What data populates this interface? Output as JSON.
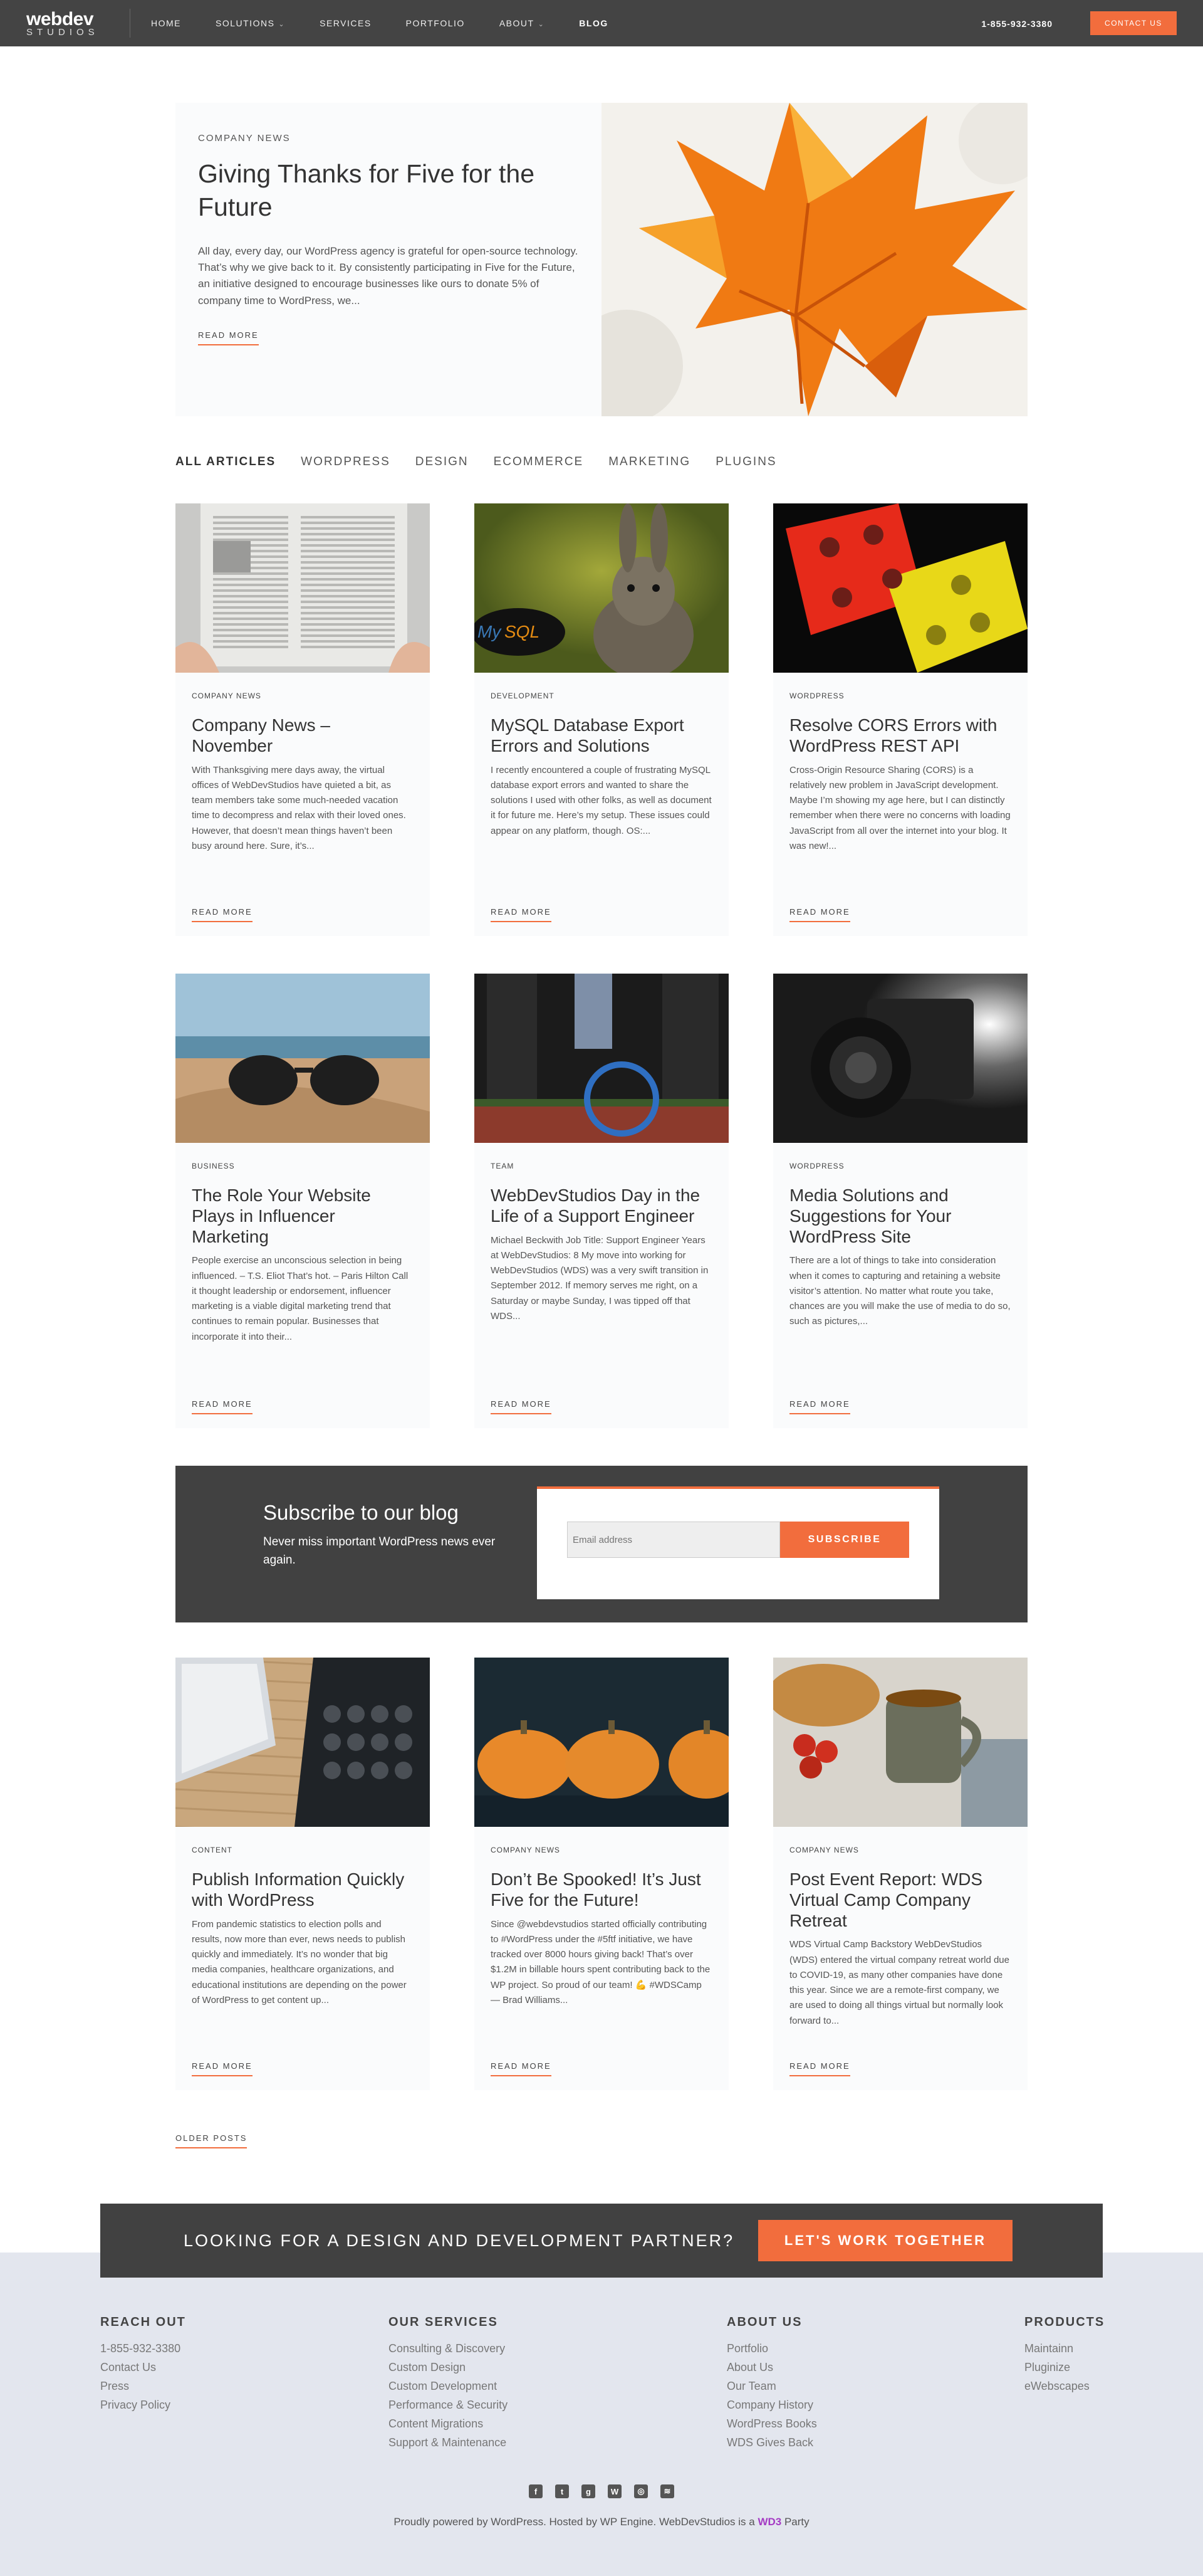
{
  "nav": {
    "logo_top": "webdev",
    "logo_bottom": "STUDIOS",
    "items": [
      {
        "label": "HOME",
        "caret": false
      },
      {
        "label": "SOLUTIONS",
        "caret": true
      },
      {
        "label": "SERVICES",
        "caret": false
      },
      {
        "label": "PORTFOLIO",
        "caret": false
      },
      {
        "label": "ABOUT",
        "caret": true
      },
      {
        "label": "BLOG",
        "caret": false,
        "active": true
      }
    ],
    "phone": "1-855-932-3380",
    "cta": "CONTACT US"
  },
  "featured": {
    "category": "COMPANY NEWS",
    "title": "Giving Thanks for Five for the Future",
    "excerpt": "All day, every day, our WordPress agency is grateful for open-source technology. That’s why we give back to it. By consistently participating in Five for the Future, an initiative designed to encourage businesses like ours to donate 5% of company time to WordPress, we...",
    "read_more": "READ MORE"
  },
  "filters": [
    "ALL ARTICLES",
    "WORDPRESS",
    "DESIGN",
    "ECOMMERCE",
    "MARKETING",
    "PLUGINS"
  ],
  "posts": [
    {
      "category": "COMPANY NEWS",
      "title": "Company News – November",
      "excerpt": "With Thanksgiving mere days away, the virtual offices of WebDevStudios have quieted a bit, as team members take some much-needed vacation time to decompress and relax with their loved ones. However, that doesn’t mean things haven’t been busy around here. Sure, it’s...",
      "read_more": "READ MORE",
      "image": "newspaper"
    },
    {
      "category": "DEVELOPMENT",
      "title": "MySQL Database Export Errors and Solutions",
      "excerpt": "I recently encountered a couple of frustrating MySQL database export errors and wanted to share the solutions I used with other folks, as well as document it for future me. Here’s my setup. These issues could appear on any platform, though. OS:...",
      "read_more": "READ MORE",
      "image": "rabbit",
      "badge": "MySQL"
    },
    {
      "category": "WORDPRESS",
      "title": "Resolve CORS Errors with WordPress REST API",
      "excerpt": "Cross-Origin Resource Sharing (CORS) is a relatively new problem in JavaScript development. Maybe I’m showing my age here, but I can distinctly remember when there were no concerns with loading JavaScript from all over the internet into your blog. It was new!...",
      "read_more": "READ MORE",
      "image": "dice"
    },
    {
      "category": "BUSINESS",
      "title": "The Role Your Website Plays in Influencer Marketing",
      "excerpt": "People exercise an unconscious selection in being influenced. – T.S. Eliot That’s hot. – Paris Hilton Call it thought leadership or endorsement, influencer marketing is a viable digital marketing trend that continues to remain popular. Businesses that incorporate it into their...",
      "read_more": "READ MORE",
      "image": "sunglasses"
    },
    {
      "category": "TEAM",
      "title": "WebDevStudios Day in the Life of a Support Engineer",
      "excerpt": "Michael Beckwith Job Title: Support Engineer Years at WebDevStudios: 8 My move into working for WebDevStudios (WDS) was a very swift transition in September 2012. If memory serves me right, on a Saturday or maybe Sunday, I was tipped off that WDS...",
      "read_more": "READ MORE",
      "image": "unicycle"
    },
    {
      "category": "WORDPRESS",
      "title": "Media Solutions and Suggestions for Your WordPress Site",
      "excerpt": "There are a lot of things to take into consideration when it comes to capturing and retaining a website visitor’s attention. No matter what route you take, chances are you will make the use of media to do so, such as pictures,...",
      "read_more": "READ MORE",
      "image": "camera"
    }
  ],
  "subscribe": {
    "title": "Subscribe to our blog",
    "text": "Never miss important WordPress news ever again.",
    "placeholder": "Email address",
    "button": "SUBSCRIBE"
  },
  "posts2": [
    {
      "category": "CONTENT",
      "title": "Publish Information Quickly with WordPress",
      "excerpt": "From pandemic statistics to election polls and results, now more than ever, news needs to publish quickly and immediately. It’s no wonder that big media companies, healthcare organizations, and educational institutions are depending on the power of WordPress to get content up...",
      "read_more": "READ MORE",
      "image": "typewriter"
    },
    {
      "category": "COMPANY NEWS",
      "title": "Don’t Be Spooked! It’s Just Five for the Future!",
      "excerpt": "Since @webdevstudios started officially contributing to #WordPress under the #5ftf initiative, we have tracked over 8000 hours giving back! That’s over $1.2M in billable hours spent contributing back to the WP project. So proud of our team! 💪 #WDSCamp — Brad Williams...",
      "read_more": "READ MORE",
      "image": "pumpkins"
    },
    {
      "category": "COMPANY NEWS",
      "title": "Post Event Report: WDS Virtual Camp Company Retreat",
      "excerpt": "WDS Virtual Camp Backstory WebDevStudios (WDS) entered the virtual company retreat world due to COVID-19, as many other companies have done this year. Since we are a remote-first company, we are used to doing all things virtual but normally look forward to...",
      "read_more": "READ MORE",
      "image": "coffee"
    }
  ],
  "older_posts": "OLDER POSTS",
  "cta": {
    "text": "LOOKING FOR A DESIGN AND DEVELOPMENT PARTNER?",
    "button": "LET'S WORK TOGETHER"
  },
  "footer": {
    "columns": [
      {
        "title": "REACH OUT",
        "items": [
          "1-855-932-3380",
          "Contact Us",
          "Press",
          "Privacy Policy"
        ]
      },
      {
        "title": "OUR SERVICES",
        "items": [
          "Consulting & Discovery",
          "Custom Design",
          "Custom Development",
          "Performance & Security",
          "Content Migrations",
          "Support & Maintenance"
        ]
      },
      {
        "title": "ABOUT US",
        "items": [
          "Portfolio",
          "About Us",
          "Our Team",
          "Company History",
          "WordPress Books",
          "WDS Gives Back"
        ]
      },
      {
        "title": "PRODUCTS",
        "items": [
          "Maintainn",
          "Pluginize",
          "eWebscapes"
        ]
      }
    ],
    "social": [
      {
        "icon": "facebook-icon",
        "glyph": "f"
      },
      {
        "icon": "twitter-icon",
        "glyph": "t"
      },
      {
        "icon": "github-icon",
        "glyph": "g"
      },
      {
        "icon": "wordpress-icon",
        "glyph": "W"
      },
      {
        "icon": "instagram-icon",
        "glyph": "◎"
      },
      {
        "icon": "rss-icon",
        "glyph": "≋"
      }
    ],
    "credit_text": "Proudly powered by WordPress. Hosted by WP Engine. WebDevStudios is a",
    "credit_brand": "WD3",
    "credit_tail": "Party"
  },
  "colors": {
    "accent": "#f26d3d",
    "dark": "#414141",
    "card_bg": "#fafbfc",
    "footer_bg": "#e3e6ee"
  }
}
